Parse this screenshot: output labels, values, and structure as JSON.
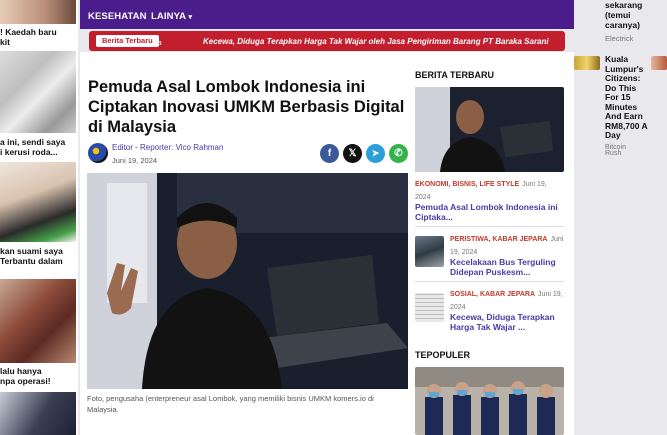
{
  "left_strip": {
    "item1": "! Kaedah baru\nkit",
    "item2": "a ini, sendi saya\ni kerusi roda...",
    "item3": "kan suami saya\nTerbantu dalam",
    "item4": "lalu hanya\nnpa operasi!"
  },
  "nav": {
    "kesehatan": "KESEHATAN",
    "lainya": "LAINYA",
    "lainya_caret": "▾"
  },
  "ticker": {
    "badge": "Berita Terbaru",
    "fragment": "ra",
    "headline": "Kecewa, Diduga Terapkan Harga Tak Wajar oleh Jasa Pengiriman Barang PT Baraka Sarani"
  },
  "article": {
    "title": "Pemuda Asal Lombok Indonesia ini Ciptakan Inovasi UMKM Berbasis Digital di Malaysia",
    "author": "Editor - Reporter: Vico Rahman",
    "date": "Juni 19, 2024",
    "caption": "Foto, pengusaha (enterpreneur asal Lombok, yang memiliki bisnis UMKM komers.io di Malaysia."
  },
  "share": {
    "facebook": "f",
    "x": "𝕏",
    "telegram": "➤",
    "whatsapp": "✆"
  },
  "sidebar": {
    "berita_terbaru": "BERITA TERBARU",
    "featured": {
      "cats": "EKONOMI, BISNIS, LIFE STYLE",
      "date": "Juni 19, 2024",
      "title": "Pemuda Asal Lombok Indonesia ini Ciptaka..."
    },
    "item1": {
      "cats": "PERISTIWA, KABAR JEPARA",
      "date": "Juni 19, 2024",
      "title": "Kecelakaan Bus Terguling Didepan Puskesm..."
    },
    "item2": {
      "cats": "SOSIAL, KABAR JEPARA",
      "date": "Juni 19, 2024",
      "title": "Kecewa, Diduga Terapkan Harga Tak Wajar ..."
    },
    "terpopuler": "TEPOPULER"
  },
  "far_right": {
    "top_text": "sekarang\n(temui\ncaranya)",
    "electrick": "Electrick",
    "ad_title": "Kuala Lumpur's Citizens: Do This For 15 Minutes And Earn RM8,700 A Day",
    "bitcoin": "Bitcoin\nRush"
  },
  "colors": {
    "nav_bg": "#4b1c8c",
    "ticker_bg": "#c31e2e",
    "link": "#4a3aa8",
    "category": "#c0392b"
  }
}
